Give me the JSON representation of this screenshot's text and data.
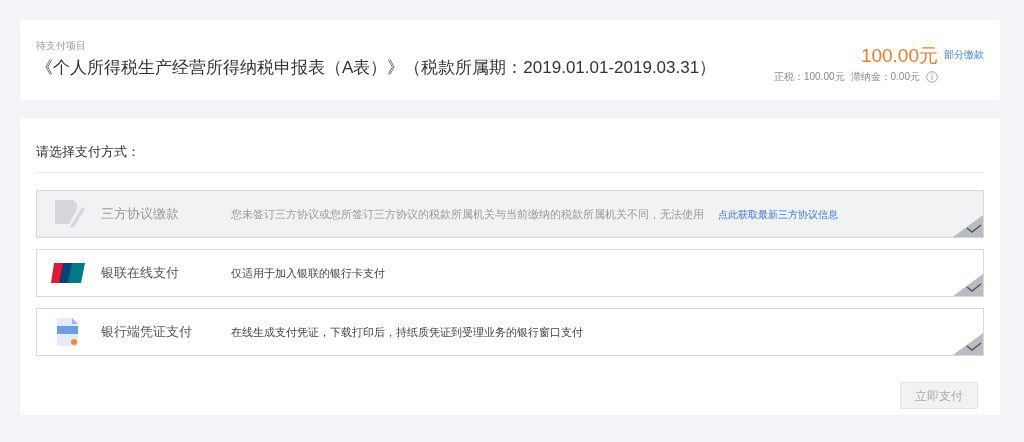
{
  "pending": {
    "caption": "待支付项目",
    "title": "《个人所得税生产经营所得纳税申报表（A表）》（税款所属期：2019.01.01-2019.03.31）",
    "amount": "100.00元",
    "partial_link": "部分缴款",
    "breakdown": [
      "正税：100.00元",
      "滞纳金：0.00元"
    ]
  },
  "payment": {
    "heading": "请选择支付方式：",
    "options": [
      {
        "kind": "protocol",
        "label": "三方协议缴款",
        "description": "您未签订三方协议或您所签订三方协议的税款所属机关与当前缴纳的税款所属机关不同，无法使用",
        "link": "点此获取最新三方协议信息",
        "disabled": true,
        "selected": false
      },
      {
        "kind": "unionpay",
        "label": "银联在线支付",
        "description": "仅适用于加入银联的银行卡支付",
        "disabled": false,
        "selected": false
      },
      {
        "kind": "voucher",
        "label": "银行端凭证支付",
        "description": "在线生成支付凭证，下载打印后，持纸质凭证到受理业务的银行窗口支付",
        "disabled": false,
        "selected": false
      }
    ],
    "pay_button": {
      "label": "立即支付",
      "disabled": true
    }
  }
}
